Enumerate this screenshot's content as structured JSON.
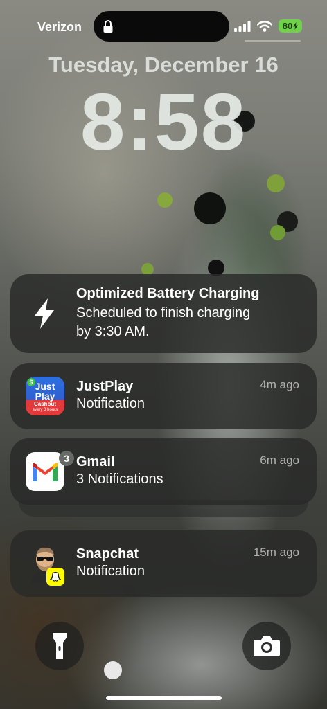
{
  "status_bar": {
    "carrier": "Verizon",
    "battery_level": "80",
    "battery_color": "#6fd14c"
  },
  "lock_screen": {
    "date": "Tuesday, December 16",
    "time": "8:58"
  },
  "notifications": [
    {
      "title": "Optimized Battery Charging",
      "body_line1": "Scheduled to finish charging",
      "body_line2": "by 3:30 AM.",
      "icon": "lightning-bolt-icon"
    },
    {
      "app": "JustPlay",
      "body": "Notification",
      "time_ago": "4m ago",
      "icon_text_1": "Just",
      "icon_text_2": "Play",
      "icon_text_3": "Cashout",
      "icon_text_4": "every 3 hours",
      "icon_badge": "$"
    },
    {
      "app": "Gmail",
      "body": "3 Notifications",
      "time_ago": "6m ago",
      "badge_count": "3"
    },
    {
      "app": "Snapchat",
      "body": "Notification",
      "time_ago": "15m ago"
    }
  ],
  "quick_actions": {
    "left": "flashlight-icon",
    "right": "camera-icon"
  }
}
